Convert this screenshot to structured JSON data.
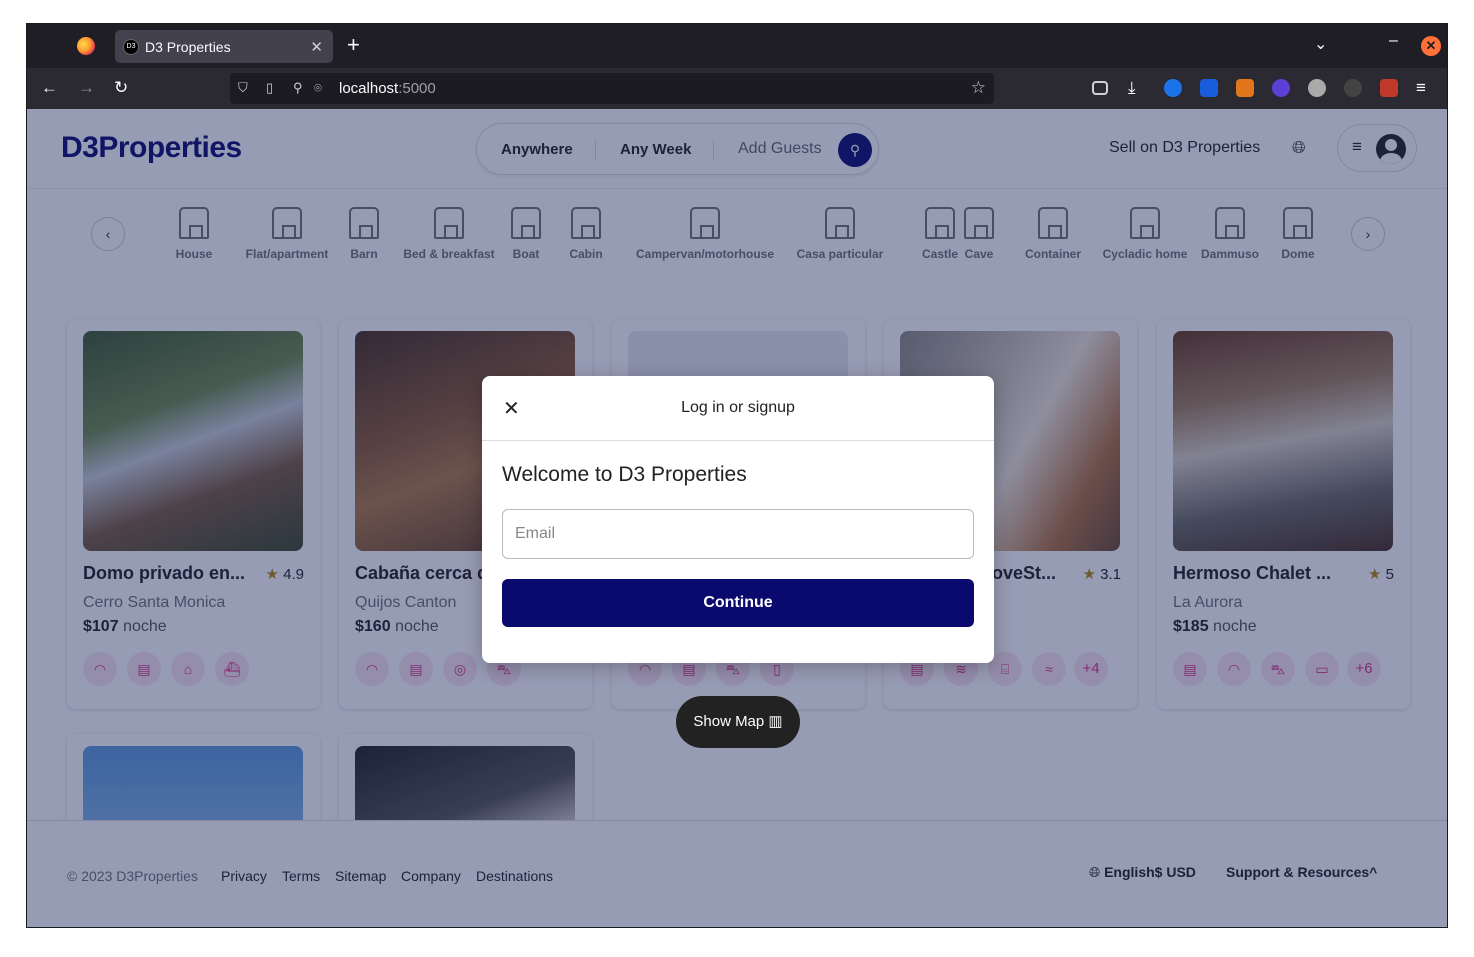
{
  "browser": {
    "tab_title": "D3 Properties",
    "tab_favicon": "D3",
    "url_host": "localhost",
    "url_port": ":5000"
  },
  "header": {
    "logo": "D3Properties",
    "search": {
      "anywhere": "Anywhere",
      "any_week": "Any Week",
      "add_guests": "Add Guests"
    },
    "sell": "Sell on D3 Properties"
  },
  "categories": [
    "House",
    "Flat/apartment",
    "Barn",
    "Bed & breakfast",
    "Boat",
    "Cabin",
    "Campervan/motorhouse",
    "Casa particular",
    "Castle",
    "Cave",
    "Container",
    "Cycladic home",
    "Dammuso",
    "Dome"
  ],
  "listings": [
    {
      "title": "Domo privado en...",
      "rating": "4.9",
      "location": "Cerro Santa Monica",
      "price": "$107",
      "unit": "noche"
    },
    {
      "title": "Cabaña cerca d",
      "rating": "",
      "location": "Quijos Canton",
      "price": "$160",
      "unit": "noche"
    },
    {
      "title": "",
      "rating": "",
      "location": "",
      "price": "",
      "unit": ""
    },
    {
      "title": "oveSt...",
      "rating": "3.1",
      "location": "",
      "price": "",
      "unit": "",
      "more": "+4"
    },
    {
      "title": "Hermoso Chalet ...",
      "rating": "5",
      "location": "La Aurora",
      "price": "$185",
      "unit": "noche",
      "more": "+6"
    }
  ],
  "show_map": "Show Map",
  "footer": {
    "copyright": "© 2023 D3Properties",
    "links": [
      "Privacy",
      "Terms",
      "Sitemap",
      "Company",
      "Destinations"
    ],
    "language": "English",
    "currency": "$ USD",
    "support": "Support & Resources"
  },
  "modal": {
    "title": "Log in or signup",
    "welcome": "Welcome to D3 Properties",
    "email_placeholder": "Email",
    "continue": "Continue"
  },
  "colors": {
    "brand": "#0a0a6e",
    "amenity": "#d63384"
  }
}
